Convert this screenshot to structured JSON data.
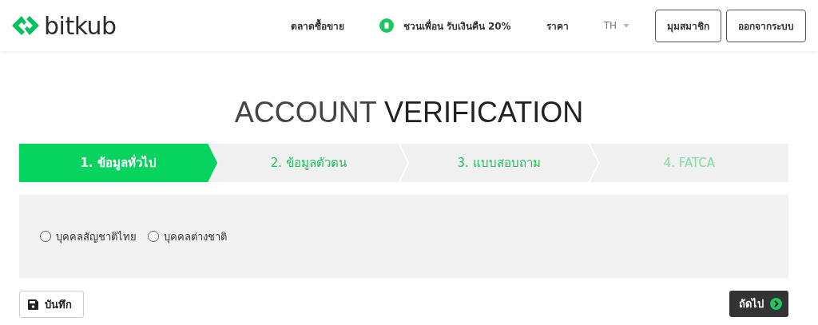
{
  "header": {
    "logo": "bitkub",
    "nav": [
      {
        "kind": "link",
        "label": "ตลาดซื้อขาย"
      },
      {
        "kind": "badge-link",
        "label": "ชวนเพื่อน รับเงินคืน 20%"
      },
      {
        "kind": "link",
        "label": "ราคา"
      },
      {
        "kind": "dropdown",
        "label": "TH"
      }
    ],
    "buttons": [
      "มุมสมาชิก",
      "ออกจากระบบ"
    ]
  },
  "title": "ACCOUNT **VERIFICATION**",
  "steps": [
    {
      "label": "1. ข้อมูลทั่วไป",
      "selected": true,
      "available": true
    },
    {
      "label": "2. ข้อมูลตัวตน",
      "selected": false,
      "available": true
    },
    {
      "label": "3. แบบสอบถาม",
      "selected": false,
      "available": true
    },
    {
      "label": "4. FATCA",
      "selected": false,
      "available": false
    }
  ],
  "options": [
    {
      "label": "บุคคลสัญชาติไทย",
      "selected": false
    },
    {
      "label": "บุคคลต่างชาติ",
      "selected": false
    }
  ],
  "save_button": "บันทึก",
  "next_button": "ถัดไป"
}
